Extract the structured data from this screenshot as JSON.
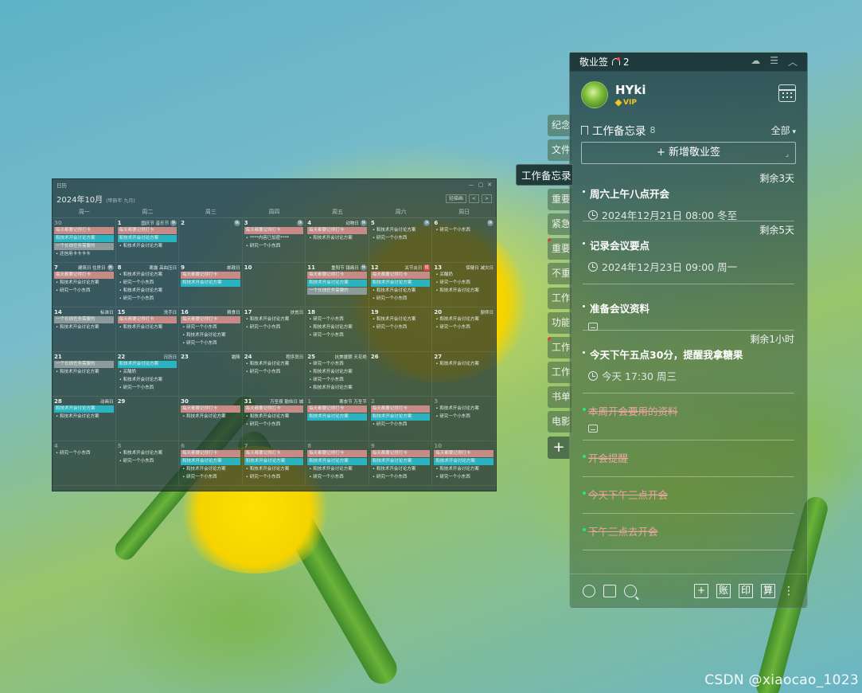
{
  "calendar": {
    "window_title": "日历",
    "month_title": "2024年10月",
    "lunar": "(甲辰年 九月)",
    "view_select": "轻描画",
    "prev": "<",
    "next": ">",
    "win_controls": [
      "—",
      "▢",
      "✕"
    ],
    "weekdays": [
      "周一",
      "周二",
      "周三",
      "周四",
      "周五",
      "周六",
      "周日"
    ],
    "weeks": [
      [
        {
          "num": "30",
          "dim": true,
          "hol": "",
          "badge": "",
          "events": [
            {
              "t": "每天都要记得打卡",
              "c": "pink"
            },
            {
              "t": "和技术开会讨论方案",
              "c": "teal"
            },
            {
              "t": "一个长线任务需要的",
              "c": "gray"
            },
            {
              "t": "还信用卡卡卡卡",
              "c": "plain"
            }
          ]
        },
        {
          "num": "1",
          "hol": "国庆节 音乐节",
          "badge": "休",
          "events": [
            {
              "t": "每天都要记得打卡",
              "c": "pink"
            },
            {
              "t": "和技术开会讨论方案",
              "c": "teal"
            },
            {
              "t": "和技术开会讨论方案",
              "c": "plain"
            }
          ]
        },
        {
          "num": "2",
          "hol": "",
          "badge": "休",
          "events": []
        },
        {
          "num": "3",
          "hol": "",
          "badge": "休",
          "events": [
            {
              "t": "每天都要记得打卡",
              "c": "pink"
            },
            {
              "t": "****内容已加密****",
              "c": "plain"
            },
            {
              "t": "研究一个小东西",
              "c": "plain"
            }
          ]
        },
        {
          "num": "4",
          "hol": "动物日",
          "badge": "休",
          "events": [
            {
              "t": "每天都要记得打卡",
              "c": "pink"
            },
            {
              "t": "和技术开会讨论方案",
              "c": "plain"
            }
          ]
        },
        {
          "num": "5",
          "hol": "",
          "badge": "休",
          "events": [
            {
              "t": "和技术开会讨论方案",
              "c": "plain"
            },
            {
              "t": "研究一个小东西",
              "c": "plain"
            }
          ]
        },
        {
          "num": "6",
          "hol": "",
          "badge": "休",
          "events": [
            {
              "t": "研究一个小东西",
              "c": "plain"
            }
          ]
        }
      ],
      [
        {
          "num": "7",
          "hol": "建筑日 住房日",
          "badge": "休",
          "events": [
            {
              "t": "每天都要记得打卡",
              "c": "pink"
            },
            {
              "t": "和技术开会讨论方案",
              "c": "plain"
            },
            {
              "t": "研究一个小东西",
              "c": "plain"
            }
          ]
        },
        {
          "num": "8",
          "hol": "寒露 高血压日",
          "badge": "",
          "events": [
            {
              "t": "和技术开会讨论方案",
              "c": "plain"
            },
            {
              "t": "研究一个小东西",
              "c": "plain"
            },
            {
              "t": "和技术开会讨论方案",
              "c": "plain"
            },
            {
              "t": "研究一个小东西",
              "c": "plain"
            }
          ]
        },
        {
          "num": "9",
          "hol": "邮政日",
          "badge": "",
          "events": [
            {
              "t": "每天都要记得打卡",
              "c": "pink"
            },
            {
              "t": "和技术开会讨论方案",
              "c": "teal"
            }
          ]
        },
        {
          "num": "10",
          "hol": "",
          "badge": "",
          "events": []
        },
        {
          "num": "11",
          "hol": "重阳节 镇痛日",
          "badge": "休",
          "events": [
            {
              "t": "每天都要记得打卡",
              "c": "pink"
            },
            {
              "t": "和技术开会讨论方案",
              "c": "teal"
            },
            {
              "t": "一个长线任务需要的",
              "c": "gray"
            }
          ]
        },
        {
          "num": "12",
          "hol": "关节炎日",
          "badge": "班",
          "events": [
            {
              "t": "每天都要记得打卡",
              "c": "pink"
            },
            {
              "t": "和技术开会讨论方案",
              "c": "teal"
            },
            {
              "t": "和技术开会讨论方案",
              "c": "plain"
            },
            {
              "t": "研究一个小东西",
              "c": "plain"
            }
          ]
        },
        {
          "num": "13",
          "hol": "保健日 减灾日",
          "badge": "",
          "events": [
            {
              "t": "买酸奶",
              "c": "plain"
            },
            {
              "t": "研究一个小东西",
              "c": "plain"
            },
            {
              "t": "和技术开会讨论方案",
              "c": "plain"
            }
          ]
        }
      ],
      [
        {
          "num": "14",
          "hol": "标准日",
          "badge": "",
          "events": [
            {
              "t": "一个长线任务需要的",
              "c": "gray"
            },
            {
              "t": "和技术开会讨论方案",
              "c": "plain"
            }
          ]
        },
        {
          "num": "15",
          "hol": "洗手日",
          "badge": "",
          "events": [
            {
              "t": "每天都要记得打卡",
              "c": "pink"
            },
            {
              "t": "和技术开会讨论方案",
              "c": "plain"
            }
          ]
        },
        {
          "num": "16",
          "hol": "粮食日",
          "badge": "",
          "events": [
            {
              "t": "每天都要记得打卡",
              "c": "pink"
            },
            {
              "t": "研究一个小东西",
              "c": "plain"
            },
            {
              "t": "和技术开会讨论方案",
              "c": "plain"
            },
            {
              "t": "研究一个小东西",
              "c": "plain"
            }
          ]
        },
        {
          "num": "17",
          "hol": "扶贫日",
          "badge": "",
          "events": [
            {
              "t": "和技术开会讨论方案",
              "c": "plain"
            },
            {
              "t": "研究一个小东西",
              "c": "plain"
            }
          ]
        },
        {
          "num": "18",
          "hol": "",
          "badge": "",
          "events": [
            {
              "t": "研究一个小东西",
              "c": "plain"
            },
            {
              "t": "和技术开会讨论方案",
              "c": "plain"
            },
            {
              "t": "研究一个小东西",
              "c": "plain"
            }
          ]
        },
        {
          "num": "19",
          "hol": "",
          "badge": "",
          "events": [
            {
              "t": "和技术开会讨论方案",
              "c": "plain"
            },
            {
              "t": "研究一个小东西",
              "c": "plain"
            }
          ]
        },
        {
          "num": "20",
          "hol": "厨师日",
          "badge": "",
          "events": [
            {
              "t": "和技术开会讨论方案",
              "c": "plain"
            },
            {
              "t": "研究一个小东西",
              "c": "plain"
            }
          ]
        }
      ],
      [
        {
          "num": "21",
          "hol": "",
          "badge": "",
          "events": [
            {
              "t": "一个长线任务需要的",
              "c": "gray"
            },
            {
              "t": "和技术开会讨论方案",
              "c": "plain"
            }
          ]
        },
        {
          "num": "22",
          "hol": "日历日",
          "badge": "",
          "events": [
            {
              "t": "和技术开会讨论方案",
              "c": "teal"
            },
            {
              "t": "买酸奶",
              "c": "plain"
            },
            {
              "t": "和技术开会讨论方案",
              "c": "plain"
            },
            {
              "t": "研究一个小东西",
              "c": "plain"
            }
          ]
        },
        {
          "num": "23",
          "hol": "霜降",
          "badge": "",
          "events": []
        },
        {
          "num": "24",
          "hol": "程序员日",
          "badge": "",
          "events": [
            {
              "t": "和技术开会讨论方案",
              "c": "plain"
            },
            {
              "t": "研究一个小东西",
              "c": "plain"
            }
          ]
        },
        {
          "num": "25",
          "hol": "抗美援朝 天花绝",
          "badge": "",
          "events": [
            {
              "t": "研究一个小东西",
              "c": "plain"
            },
            {
              "t": "和技术开会讨论方案",
              "c": "plain"
            },
            {
              "t": "研究一个小东西",
              "c": "plain"
            },
            {
              "t": "和技术开会讨论方案",
              "c": "plain"
            }
          ]
        },
        {
          "num": "26",
          "hol": "",
          "badge": "",
          "events": []
        },
        {
          "num": "27",
          "hol": "",
          "badge": "",
          "events": [
            {
              "t": "和技术开会讨论方案",
              "c": "plain"
            }
          ]
        }
      ],
      [
        {
          "num": "28",
          "hol": "动画日",
          "badge": "",
          "events": [
            {
              "t": "和技术开会讨论方案",
              "c": "teal"
            },
            {
              "t": "和技术开会讨论方案",
              "c": "plain"
            }
          ]
        },
        {
          "num": "29",
          "hol": "",
          "badge": "",
          "events": []
        },
        {
          "num": "30",
          "hol": "",
          "badge": "",
          "events": [
            {
              "t": "每天都要记得打卡",
              "c": "pink"
            },
            {
              "t": "和技术开会讨论方案",
              "c": "plain"
            }
          ]
        },
        {
          "num": "31",
          "hol": "万圣夜 勤俭日 城",
          "badge": "",
          "events": [
            {
              "t": "每天都要记得打卡",
              "c": "pink"
            },
            {
              "t": "和技术开会讨论方案",
              "c": "plain"
            },
            {
              "t": "研究一个小东西",
              "c": "plain"
            }
          ]
        },
        {
          "num": "1",
          "dim": true,
          "hol": "寒衣节 万圣节",
          "badge": "",
          "events": [
            {
              "t": "每天都要记得打卡",
              "c": "pink"
            },
            {
              "t": "和技术开会讨论方案",
              "c": "teal"
            }
          ]
        },
        {
          "num": "2",
          "dim": true,
          "hol": "",
          "badge": "",
          "events": [
            {
              "t": "每天都要记得打卡",
              "c": "pink"
            },
            {
              "t": "和技术开会讨论方案",
              "c": "teal"
            },
            {
              "t": "研究一个小东西",
              "c": "plain"
            }
          ]
        },
        {
          "num": "3",
          "dim": true,
          "hol": "",
          "badge": "",
          "events": [
            {
              "t": "和技术开会讨论方案",
              "c": "plain"
            },
            {
              "t": "研究一个小东西",
              "c": "plain"
            }
          ]
        }
      ],
      [
        {
          "num": "4",
          "dim": true,
          "hol": "",
          "badge": "",
          "events": [
            {
              "t": "研究一个小东西",
              "c": "plain"
            }
          ]
        },
        {
          "num": "5",
          "dim": true,
          "hol": "",
          "badge": "",
          "events": [
            {
              "t": "和技术开会讨论方案",
              "c": "plain"
            },
            {
              "t": "研究一个小东西",
              "c": "plain"
            }
          ]
        },
        {
          "num": "6",
          "dim": true,
          "hol": "",
          "badge": "",
          "events": [
            {
              "t": "每天都要记得打卡",
              "c": "pink"
            },
            {
              "t": "和技术开会讨论方案",
              "c": "teal"
            },
            {
              "t": "和技术开会讨论方案",
              "c": "plain"
            },
            {
              "t": "研究一个小东西",
              "c": "plain"
            }
          ]
        },
        {
          "num": "7",
          "dim": true,
          "hol": "",
          "badge": "",
          "events": [
            {
              "t": "每天都要记得打卡",
              "c": "pink"
            },
            {
              "t": "和技术开会讨论方案",
              "c": "teal"
            },
            {
              "t": "和技术开会讨论方案",
              "c": "plain"
            },
            {
              "t": "研究一个小东西",
              "c": "plain"
            }
          ]
        },
        {
          "num": "8",
          "dim": true,
          "hol": "",
          "badge": "",
          "events": [
            {
              "t": "每天都要记得打卡",
              "c": "pink"
            },
            {
              "t": "和技术开会讨论方案",
              "c": "teal"
            },
            {
              "t": "和技术开会讨论方案",
              "c": "plain"
            },
            {
              "t": "研究一个小东西",
              "c": "plain"
            }
          ]
        },
        {
          "num": "9",
          "dim": true,
          "hol": "",
          "badge": "",
          "events": [
            {
              "t": "每天都要记得打卡",
              "c": "pink"
            },
            {
              "t": "和技术开会讨论方案",
              "c": "teal"
            },
            {
              "t": "和技术开会讨论方案",
              "c": "plain"
            },
            {
              "t": "研究一个小东西",
              "c": "plain"
            }
          ]
        },
        {
          "num": "10",
          "dim": true,
          "hol": "",
          "badge": "",
          "events": [
            {
              "t": "每天都要记得打卡",
              "c": "pink"
            },
            {
              "t": "和技术开会讨论方案",
              "c": "teal"
            },
            {
              "t": "和技术开会讨论方案",
              "c": "plain"
            },
            {
              "t": "研究一个小东西",
              "c": "plain"
            }
          ]
        }
      ]
    ]
  },
  "tabs": [
    {
      "label": "纪念",
      "dot": false
    },
    {
      "label": "文件",
      "dot": false
    },
    {
      "label": "工作备忘录",
      "dot": false,
      "active": true
    },
    {
      "label": "重要",
      "dot": false
    },
    {
      "label": "紧急",
      "dot": false
    },
    {
      "label": "重要",
      "dot": true
    },
    {
      "label": "不重",
      "dot": false
    },
    {
      "label": "工作",
      "dot": false
    },
    {
      "label": "功能",
      "dot": false
    },
    {
      "label": "工作",
      "dot": true
    },
    {
      "label": "工作",
      "dot": false
    },
    {
      "label": "书单",
      "dot": false
    },
    {
      "label": "电影",
      "dot": false
    }
  ],
  "tab_add_label": "+",
  "panel": {
    "app_name": "敬业签",
    "notif_count": "2",
    "user": {
      "name": "HYki",
      "vip": "VIP"
    },
    "category": {
      "title": "工作备忘录",
      "count": "8",
      "filter": "全部"
    },
    "add_label": "+ 新增敬业签",
    "resize_mark": "⌟",
    "notes": [
      {
        "remain": "剩余3天",
        "title": "周六上午八点开会",
        "time": "2024年12月21日 08:00 冬至",
        "type": "timed"
      },
      {
        "remain": "剩余5天",
        "title": "记录会议要点",
        "time": "2024年12月23日 09:00 周一",
        "type": "timed"
      },
      {
        "remain": "",
        "title": "准备会议资料",
        "time": "",
        "type": "attach"
      },
      {
        "remain": "剩余1小时",
        "title": "今天下午五点30分，提醒我拿糖果",
        "time": "今天 17:30 周三",
        "type": "timed"
      }
    ],
    "done": [
      {
        "title": "本周开会要用的资料",
        "attach": true
      },
      {
        "title": "开会提醒",
        "attach": false
      },
      {
        "title": "今天下午三点开会",
        "attach": false
      },
      {
        "title": "下午三点去开会",
        "attach": false
      }
    ],
    "bottom_buttons": [
      "账",
      "印",
      "算"
    ]
  },
  "watermark": "CSDN @xiaocao_1023",
  "colors": {
    "accent_pink": "#c78a86",
    "accent_teal": "#2ab3c0",
    "done_red": "#e8a6a0",
    "done_dot": "#2de08a",
    "vip": "#f5c425"
  }
}
